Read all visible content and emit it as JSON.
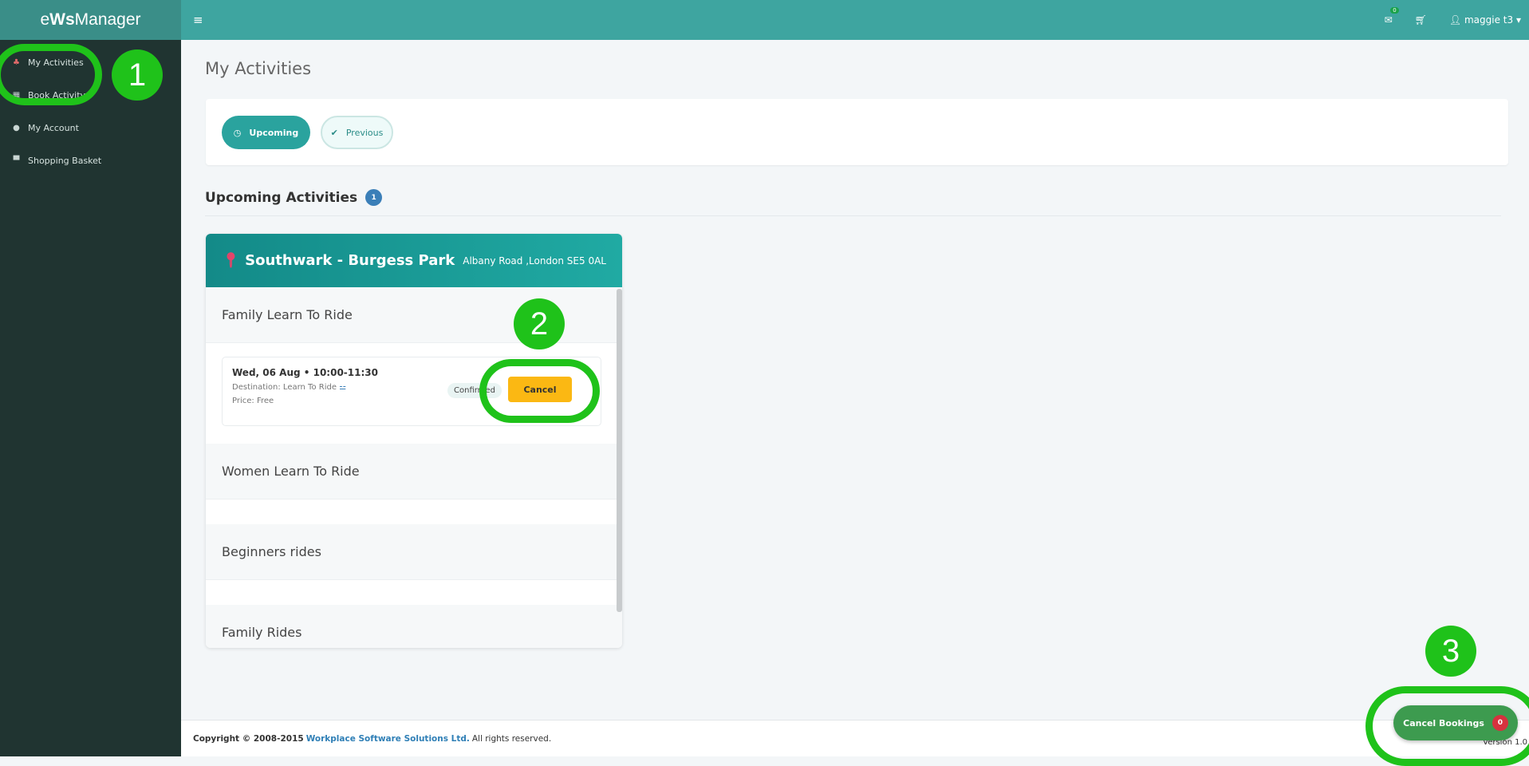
{
  "app": {
    "brand_prefix": "e",
    "brand_bold": "Ws",
    "brand_suffix": "Manager"
  },
  "sidebar": {
    "items": [
      {
        "label": "My Activities",
        "icon": "bicycle-icon"
      },
      {
        "label": "Book Activity",
        "icon": "calendar-icon"
      },
      {
        "label": "My Account",
        "icon": "user-icon"
      },
      {
        "label": "Shopping Basket",
        "icon": "cart-icon"
      }
    ]
  },
  "topbar": {
    "mail_count": "0",
    "user": "maggie t3"
  },
  "main": {
    "title": "My Activities",
    "tabs": [
      {
        "label": "Upcoming"
      },
      {
        "label": "Previous"
      }
    ],
    "section_title": "Upcoming Activities",
    "section_count": "1"
  },
  "card": {
    "location": "Southwark - Burgess Park",
    "address": "Albany Road ,London SE5 0AL",
    "activities": [
      "Family Learn To Ride",
      "Women Learn To Ride",
      "Beginners rides",
      "Family Rides"
    ],
    "session": {
      "datetime": "Wed, 06 Aug • 10:00-11:30",
      "destination": "Destination: Learn To Ride",
      "price": "Price: Free",
      "status": "Confirmed",
      "cancel_label": "Cancel"
    }
  },
  "footer": {
    "copyright": "Copyright © 2008-2015",
    "company": "Workplace Software Solutions Ltd.",
    "rights": "All rights reserved.",
    "version": "Version 1.0"
  },
  "cancel_bookings": {
    "label": "Cancel Bookings",
    "count": "0"
  },
  "annotations": [
    "1",
    "2",
    "3"
  ],
  "colors": {
    "accent": "#3ea5a0",
    "sidebar": "#203431",
    "cancel": "#fbb813",
    "annotation": "#1fc21a"
  }
}
